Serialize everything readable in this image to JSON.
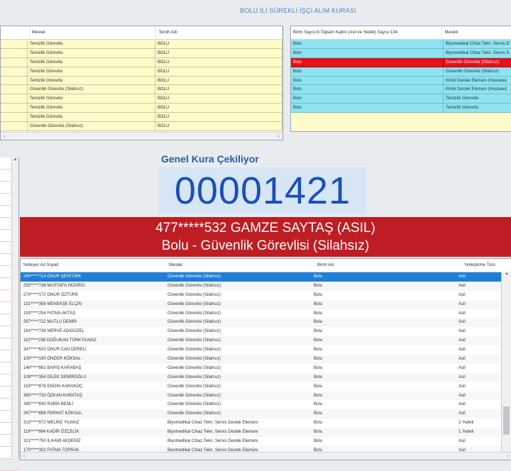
{
  "app": {
    "title": "BOLU İLİ SÜREKLİ İŞÇİ ALIM KURASI"
  },
  "left_table": {
    "columns": [
      "",
      "Meslek",
      "Tercih Adı"
    ],
    "rows": [
      [
        "",
        "Temizlik Görevlisi",
        "BOLU"
      ],
      [
        "",
        "Temizlik Görevlisi",
        "BOLU"
      ],
      [
        "",
        "Temizlik Görevlisi",
        "BOLU"
      ],
      [
        "",
        "Temizlik Görevlisi",
        "BOLU"
      ],
      [
        "",
        "Temizlik Görevlisi",
        "BOLU"
      ],
      [
        "",
        "Güvenlik Görevlisi (Silahsız)",
        "BOLU"
      ],
      [
        "",
        "Temizlik Görevlisi",
        "BOLU"
      ],
      [
        "",
        "Temizlik Görevlisi",
        "BOLU"
      ],
      [
        "",
        "Temizlik Görevlisi",
        "BOLU"
      ],
      [
        "",
        "Güvenlik Görevlisi (Silahsız)",
        "BOLU"
      ]
    ]
  },
  "right_table": {
    "columns": [
      "Birim Sayısı:8 Toplam Kadro (Asil ve Yedek) Sayısı:134",
      "Meslek"
    ],
    "rows": [
      [
        "Bolu",
        "Biyomedikal Cihaz Tekn. Servis D"
      ],
      [
        "Bolu",
        "Biyomedikal Cihaz Tekn. Servis D"
      ],
      [
        "Bolu",
        "Güvenlik Görevlisi (Silahsız)"
      ],
      [
        "Bolu",
        "Güvenlik Görevlisi (Silahsız)"
      ],
      [
        "Bolu",
        "Klinik Destek Elemanı (Hastane)"
      ],
      [
        "Bolu",
        "Klinik Destek Elemanı (Hastane)"
      ],
      [
        "Bolu",
        "Temizlik Görevlisi"
      ],
      [
        "Bolu",
        "Temizlik Görevlisi"
      ]
    ],
    "selected_index": 2
  },
  "draw": {
    "label": "Genel Kura Çekiliyor",
    "counter": "00001421",
    "winner_line1": "477*****532 GAMZE SAYTAŞ (ASIL)",
    "winner_line2": "Bolu - Güvenlik Görevlisi (Silahsız)"
  },
  "results_table": {
    "columns": [
      "Yerleşen Ad Soyad",
      "Meslek",
      "Birim Adı",
      "Yerleştirme Türü"
    ],
    "rows": [
      [
        "240*****714 ONUR ŞENTÜRK",
        "Güvenlik Görevlisi (Silahsız)",
        "Bolu",
        "Asil"
      ],
      [
        "250*****738 MUSTAFA HIZARCI",
        "Güvenlik Görevlisi (Silahsız)",
        "Bolu",
        "Asil"
      ],
      [
        "270*****172 ONUR ÖZTÜRK",
        "Güvenlik Görevlisi (Silahsız)",
        "Bolu",
        "Asil"
      ],
      [
        "131*****356 MENEKŞE ELÇİN",
        "Güvenlik Görevlisi (Silahsız)",
        "Bolu",
        "Asil"
      ],
      [
        "193*****254 FATMA AKTAŞ",
        "Güvenlik Görevlisi (Silahsız)",
        "Bolu",
        "Asil"
      ],
      [
        "297*****722 MUTLU DEMİR",
        "Güvenlik Görevlisi (Silahsız)",
        "Bolu",
        "Asil"
      ],
      [
        "163*****736 MERVE ADIGÜZEL",
        "Güvenlik Görevlisi (Silahsız)",
        "Bolu",
        "Asil"
      ],
      [
        "110*****298 DOĞUKAN TÜRKYILMAZ",
        "Güvenlik Görevlisi (Silahsız)",
        "Bolu",
        "Asil"
      ],
      [
        "347*****620 ONUR CAN DERELİ",
        "Güvenlik Görevlisi (Silahsız)",
        "Bolu",
        "Asil"
      ],
      [
        "100*****190 ÖNDER KÖKSAL",
        "Güvenlik Görevlisi (Silahsız)",
        "Bolu",
        "Asil"
      ],
      [
        "148*****862 BARIŞ KARABAŞ",
        "Güvenlik Görevlisi (Silahsız)",
        "Bolu",
        "Asil"
      ],
      [
        "108*****354 DİLEK DEMİROĞLU",
        "Güvenlik Görevlisi (Silahsız)",
        "Bolu",
        "Asil"
      ],
      [
        "193*****878 ENGİN KARAKOÇ",
        "Güvenlik Görevlisi (Silahsız)",
        "Bolu",
        "Asil"
      ],
      [
        "365*****730 ÖZKAN KARATAŞ",
        "Güvenlik Görevlisi (Silahsız)",
        "Bolu",
        "Asil"
      ],
      [
        "385*****840 RABİA BENLİ",
        "Güvenlik Görevlisi (Silahsız)",
        "Bolu",
        "Asil"
      ],
      [
        "267*****898 FERHAT KÖKSAL",
        "Güvenlik Görevlisi (Silahsız)",
        "Bolu",
        "Asil"
      ],
      [
        "313*****972 MELİKE YILMAZ",
        "Biyomedikal Cihaz Tekn. Servis Destek Elemanı",
        "Bolu",
        "2.Yedek"
      ],
      [
        "119*****984 KADİR ÖZÇELİK",
        "Biyomedikal Cihaz Tekn. Servis Destek Elemanı",
        "Bolu",
        "1.Yedek"
      ],
      [
        "321*****750 İLHAMİ AKDENİZ",
        "Biyomedikal Cihaz Tekn. Servis Destek Elemanı",
        "Bolu",
        "Asil"
      ],
      [
        "170*****302 FATMA TOPRAK",
        "Biyomedikal Cihaz Tekn. Servis Destek Elemanı",
        "Bolu",
        "Asil"
      ]
    ],
    "selected_index": 0
  },
  "colors": {
    "accent": "#1f5fa6",
    "winner_bg": "#be1d24",
    "counter_bg": "#d6e6f4",
    "row_yellow": "#fdfbc7",
    "row_cyan": "#8fe3f1",
    "row_selected_red": "#e4101c",
    "row_selected_blue": "#1e7ed8"
  },
  "icons": {
    "scroll_left": "‹",
    "scroll_right": "›",
    "scroll_up": "▲",
    "scroll_down": "▼"
  }
}
